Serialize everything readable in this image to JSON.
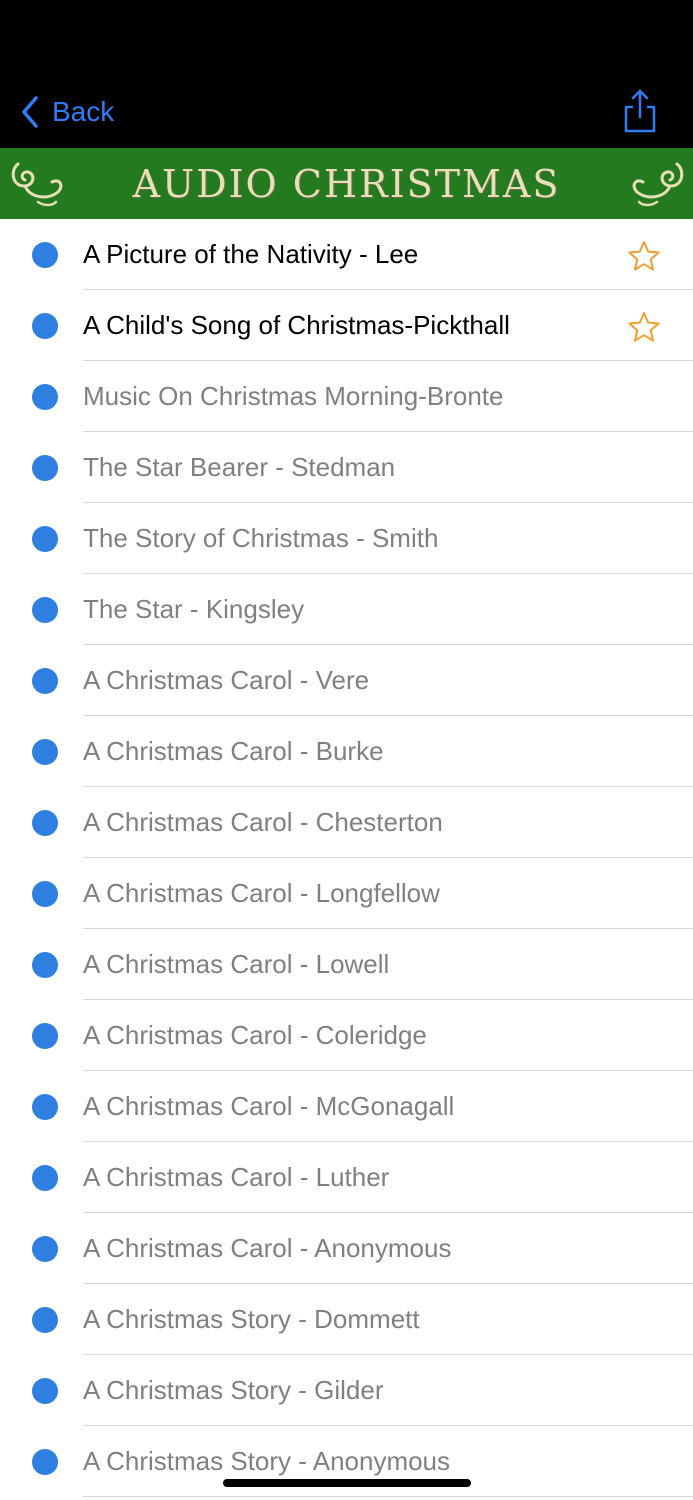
{
  "nav": {
    "back_label": "Back",
    "accent_color": "#2f7cf6"
  },
  "banner": {
    "title": "AUDIO CHRISTMAS",
    "background": "#237a1f"
  },
  "list": {
    "bullet_color": "#2e7fe0",
    "star_color": "#f0a030",
    "items": [
      {
        "title": "A Picture of the Nativity - Lee",
        "starred": true
      },
      {
        "title": "A Child's Song of Christmas-Pickthall",
        "starred": true
      },
      {
        "title": "Music On Christmas Morning-Bronte",
        "starred": false
      },
      {
        "title": "The Star Bearer - Stedman",
        "starred": false
      },
      {
        "title": "The Story of Christmas - Smith",
        "starred": false
      },
      {
        "title": "The Star - Kingsley",
        "starred": false
      },
      {
        "title": "A Christmas Carol - Vere",
        "starred": false
      },
      {
        "title": "A Christmas Carol - Burke",
        "starred": false
      },
      {
        "title": "A Christmas Carol - Chesterton",
        "starred": false
      },
      {
        "title": "A Christmas Carol - Longfellow",
        "starred": false
      },
      {
        "title": "A Christmas Carol - Lowell",
        "starred": false
      },
      {
        "title": "A Christmas Carol - Coleridge",
        "starred": false
      },
      {
        "title": "A Christmas Carol - McGonagall",
        "starred": false
      },
      {
        "title": "A Christmas Carol - Luther",
        "starred": false
      },
      {
        "title": "A Christmas Carol - Anonymous",
        "starred": false
      },
      {
        "title": "A Christmas Story - Dommett",
        "starred": false
      },
      {
        "title": "A Christmas Story - Gilder",
        "starred": false
      },
      {
        "title": "A Christmas Story - Anonymous",
        "starred": false
      }
    ]
  }
}
